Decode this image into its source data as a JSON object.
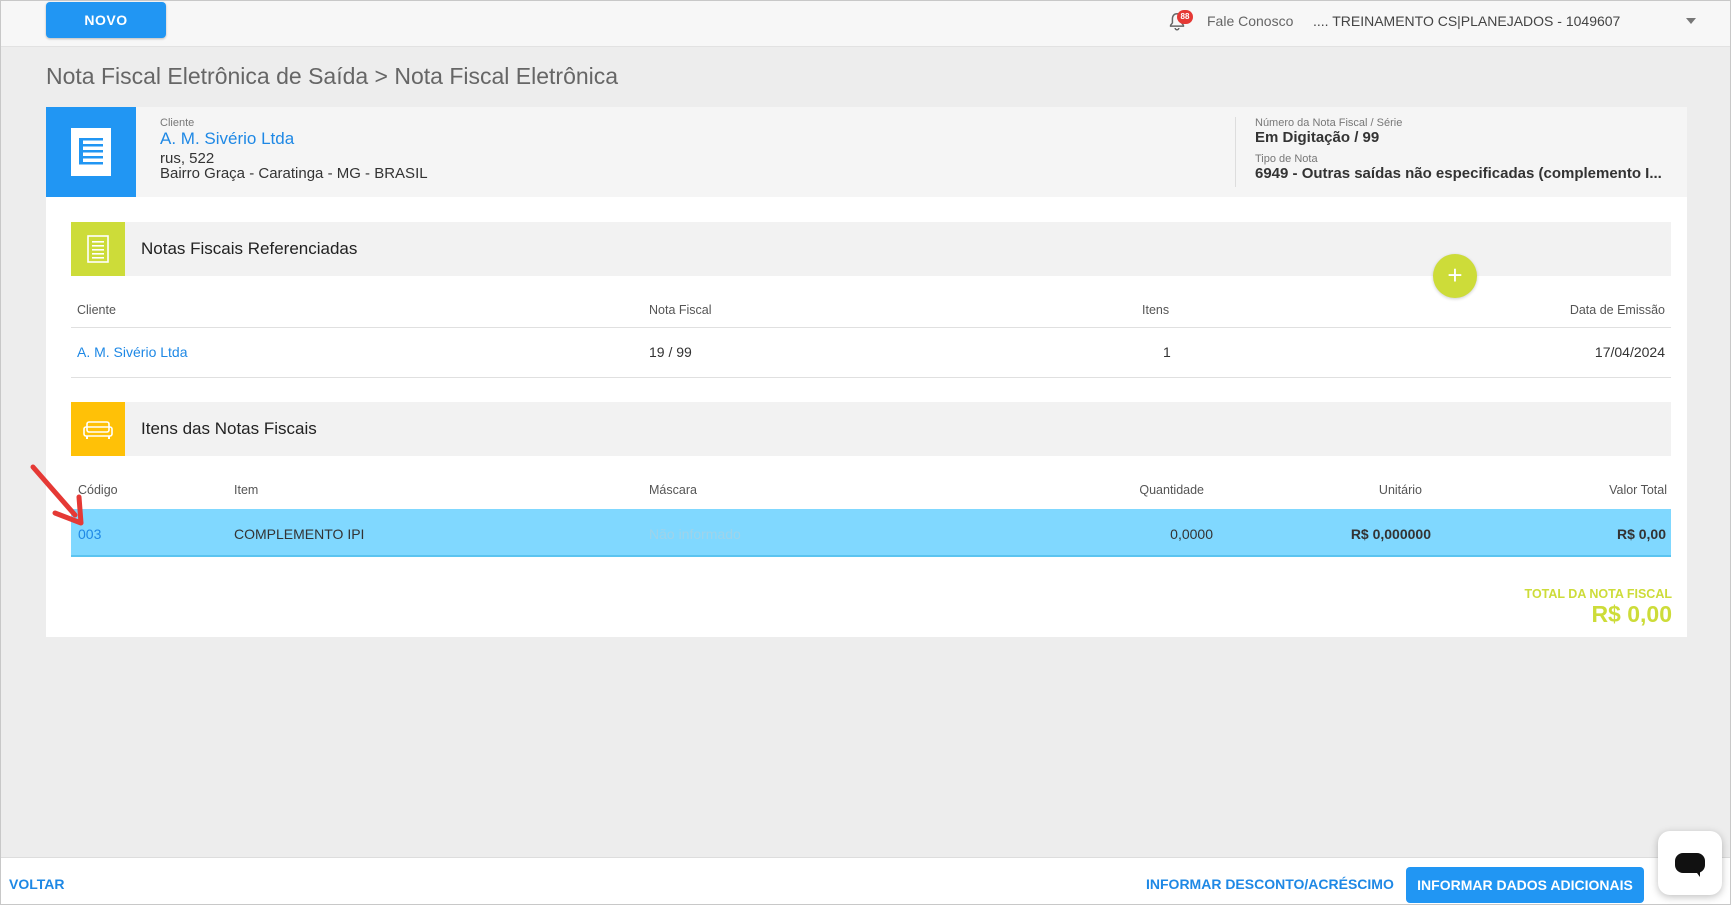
{
  "topbar": {
    "novo_label": "NOVO",
    "notification_count": "88",
    "fale_conosco": "Fale Conosco",
    "company": ".... TREINAMENTO CS|PLANEJADOS - 1049607"
  },
  "breadcrumb": "Nota Fiscal Eletrônica de Saída > Nota Fiscal Eletrônica",
  "header": {
    "cliente_label": "Cliente",
    "cliente_name": "A. M. Sivério Ltda",
    "address_line1": "rus, 522",
    "address_line2": "Bairro Graça - Caratinga - MG - BRASIL",
    "numero_label": "Número da Nota Fiscal / Série",
    "numero_value": "Em Digitação / 99",
    "tipo_label": "Tipo de Nota",
    "tipo_value": "6949 - Outras saídas não especificadas (complemento I..."
  },
  "referenciadas": {
    "title": "Notas Fiscais Referenciadas",
    "add_label": "+",
    "columns": [
      "Cliente",
      "Nota Fiscal",
      "Itens",
      "Data de Emissão"
    ],
    "rows": [
      {
        "cliente": "A. M. Sivério Ltda",
        "nota": "19 / 99",
        "itens": "1",
        "data": "17/04/2024"
      }
    ]
  },
  "itens": {
    "title": "Itens das Notas Fiscais",
    "columns": [
      "Código",
      "Item",
      "Máscara",
      "Quantidade",
      "Unitário",
      "Valor Total"
    ],
    "rows": [
      {
        "codigo": "003",
        "item": "COMPLEMENTO IPI",
        "mascara": "Não informado",
        "quantidade": "0,0000",
        "unitario": "R$ 0,000000",
        "total": "R$ 0,00"
      }
    ]
  },
  "total": {
    "label": "TOTAL DA NOTA FISCAL",
    "value": "R$ 0,00"
  },
  "bottombar": {
    "voltar": "VOLTAR",
    "desconto": "INFORMAR DESCONTO/ACRÉSCIMO",
    "dados": "INFORMAR DADOS ADICIONAIS"
  },
  "colors": {
    "primary": "#2196f3",
    "lime": "#cddc39",
    "amber": "#ffc107",
    "selected_row": "#80d8ff",
    "arrow": "#e53935"
  },
  "icons": [
    "bell-icon",
    "document-icon",
    "list-icon",
    "sofa-icon",
    "plus-icon",
    "chat-icon",
    "arrow-annotation-icon",
    "caret-down-icon"
  ]
}
